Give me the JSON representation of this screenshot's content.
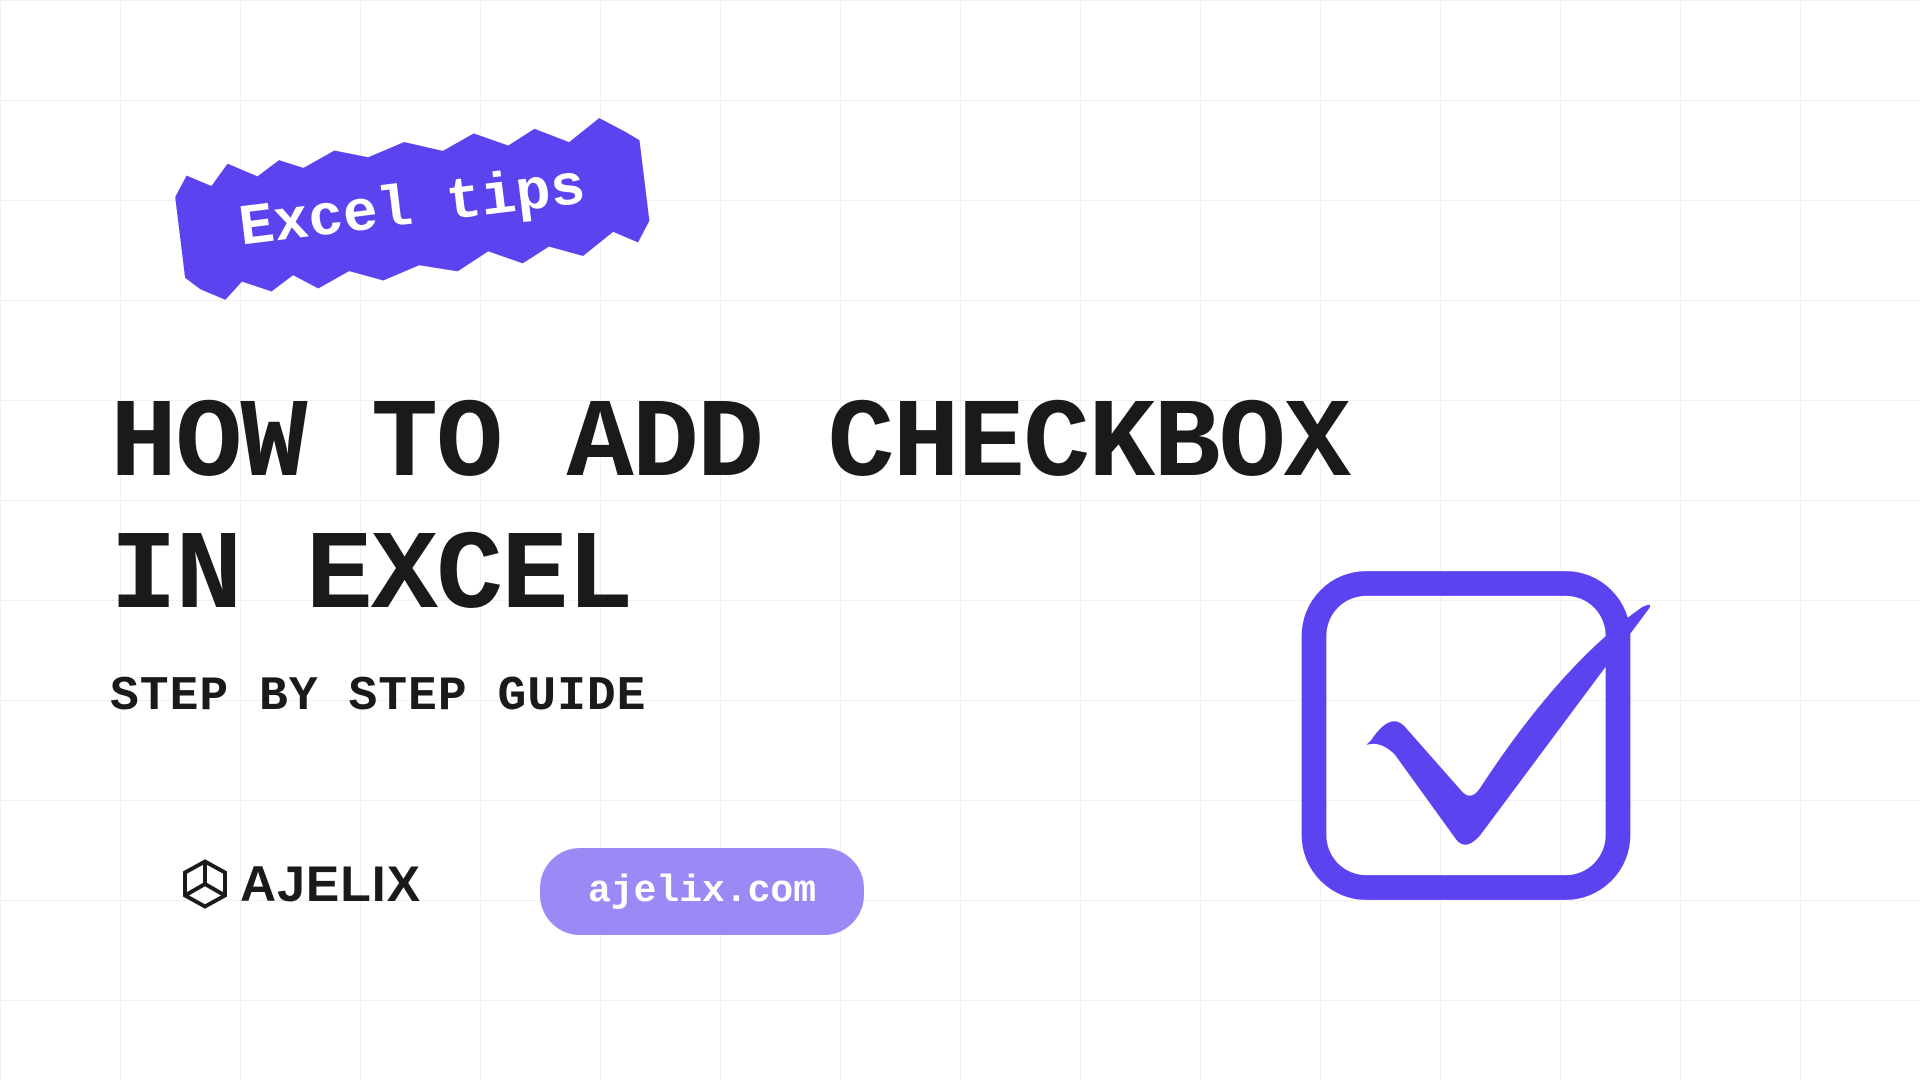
{
  "tape": {
    "text": "Excel tips"
  },
  "title": {
    "line1": "HOW TO ADD CHECKBOX",
    "line2": "IN EXCEL"
  },
  "subtitle": "STEP BY STEP GUIDE",
  "brand": {
    "name": "AJELIX"
  },
  "url": "ajelix.com",
  "colors": {
    "primary": "#5B43F0",
    "secondary": "#9B8AF5",
    "text": "#1a1a1a"
  }
}
